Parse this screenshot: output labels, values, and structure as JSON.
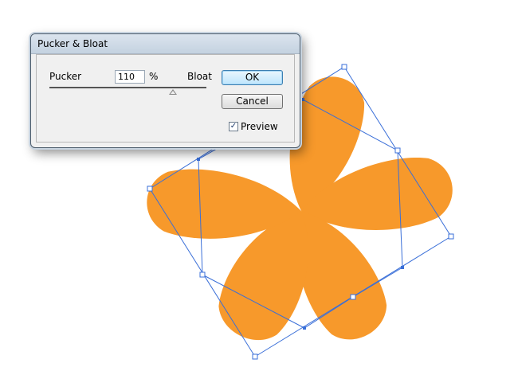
{
  "dialog": {
    "title": "Pucker & Bloat",
    "pucker_label": "Pucker",
    "bloat_label": "Bloat",
    "amount_value": "110",
    "amount_unit": "%",
    "slider_value_percent": 110,
    "ok_label": "OK",
    "cancel_label": "Cancel",
    "preview_label": "Preview",
    "preview_checked": true,
    "check_glyph": "✓"
  },
  "artwork": {
    "fill_color": "#f7992b",
    "bbox_stroke_color": "#3a6fd8",
    "petal_count": 5
  }
}
